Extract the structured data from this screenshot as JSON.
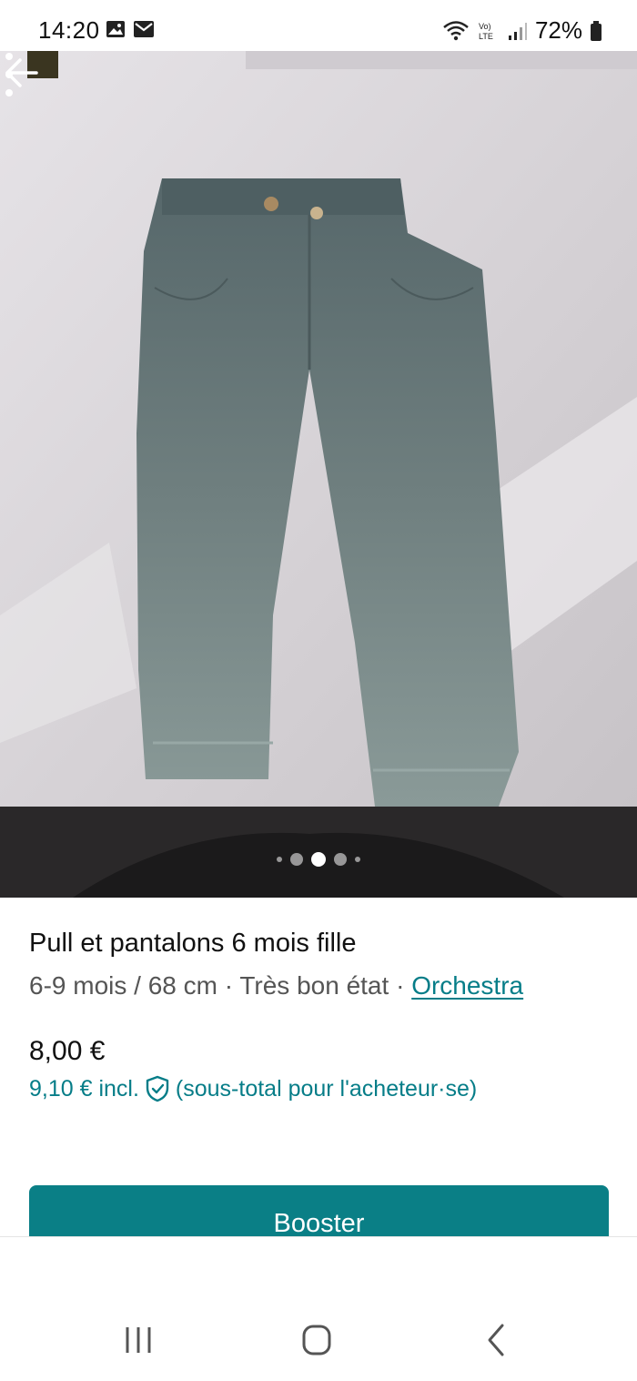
{
  "status_bar": {
    "time": "14:20",
    "left_icons": [
      "image-icon",
      "mail-icon"
    ],
    "right_icons": [
      "wifi-icon",
      "volte-icon",
      "signal-icon"
    ],
    "battery_text": "72%"
  },
  "photo": {
    "back_icon": "arrow-left-icon",
    "menu_icon": "more-vertical-icon",
    "pager": {
      "count": 5,
      "active_index": 2
    }
  },
  "listing": {
    "title": "Pull et pantalons 6 mois fille",
    "size": "6-9 mois / 68 cm",
    "sep1": " · ",
    "condition": "Très bon état",
    "sep2": " · ",
    "brand": "Orchestra",
    "price": "8,00 €",
    "price_incl": "9,10 € incl.",
    "price_incl_note": "(sous-total pour l'acheteur·se)",
    "protection_icon": "shield-check-icon"
  },
  "actions": {
    "booster_label": "Booster"
  },
  "navbar": {
    "icons": [
      "recent-apps-icon",
      "home-icon",
      "back-icon"
    ]
  },
  "colors": {
    "accent": "#0a7f86",
    "link": "#067d88"
  }
}
